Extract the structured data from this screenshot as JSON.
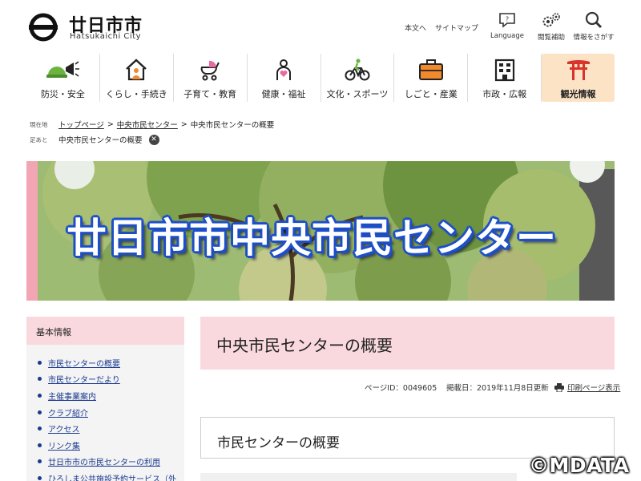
{
  "header": {
    "site_name": "廿日市市",
    "site_sub": "Hatsukaichi City",
    "links": {
      "main_text": "本文へ",
      "sitemap": "サイトマップ"
    },
    "tools": [
      {
        "icon": "language-icon",
        "label": "Language"
      },
      {
        "icon": "reading-assist-icon",
        "label": "閲覧補助"
      },
      {
        "icon": "search-icon",
        "label": "情報をさがす"
      }
    ]
  },
  "nav": [
    {
      "icon": "megaphone-helmet-icon",
      "label": "防災・安全"
    },
    {
      "icon": "house-icon",
      "label": "くらし・手続き"
    },
    {
      "icon": "stroller-icon",
      "label": "子育て・教育"
    },
    {
      "icon": "health-icon",
      "label": "健康・福祉"
    },
    {
      "icon": "bicycle-icon",
      "label": "文化・スポーツ"
    },
    {
      "icon": "briefcase-icon",
      "label": "しごと・産業"
    },
    {
      "icon": "building-icon",
      "label": "市政・広報"
    },
    {
      "icon": "torii-icon",
      "label": "観光情報"
    }
  ],
  "breadcrumb": {
    "current_tag": "現在地",
    "items": [
      "トップページ",
      "中央市民センター",
      "中央市民センターの概要"
    ],
    "footprint_tag": "足あと",
    "footprint_item": "中央市民センターの概要"
  },
  "banner": {
    "title": "廿日市市中央市民センター"
  },
  "sidebar": {
    "heading": "基本情報",
    "items": [
      "市民センターの概要",
      "市民センターだより",
      "主催事業案内",
      "クラブ紹介",
      "アクセス",
      "リンク集",
      "廿日市市の市民センターの利用",
      "ひろしま公共施設予約サービス（外"
    ]
  },
  "main": {
    "title": "中央市民センターの概要",
    "page_id": "ページID：0049605",
    "posted": "掲載日：2019年11月8日更新",
    "print": "印刷ページ表示",
    "section_title": "市民センターの概要"
  },
  "watermark": "©MDATA",
  "colors": {
    "accent_pink": "#f9d9de",
    "tourism_tab": "#fde3c5",
    "link": "#1a3a8f"
  }
}
